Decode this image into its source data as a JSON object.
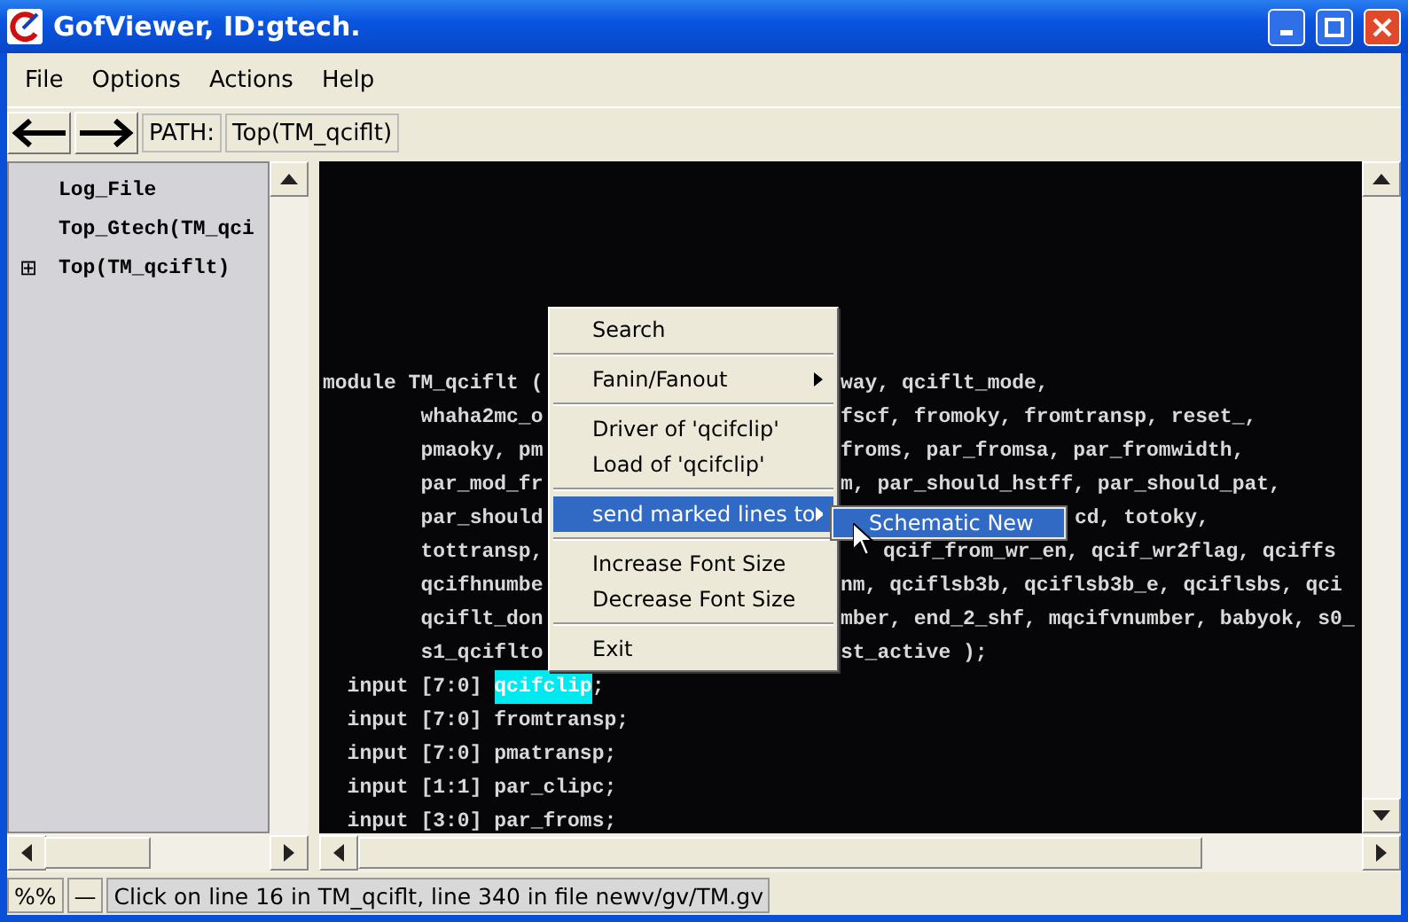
{
  "window": {
    "title": "GofViewer, ID:gtech."
  },
  "menu_bar": [
    "File",
    "Options",
    "Actions",
    "Help"
  ],
  "toolbar": {
    "path_label": "PATH:",
    "path": "Top(TM_qciflt)"
  },
  "tree": [
    {
      "label": "Log_File",
      "kind": "leaf"
    },
    {
      "label": "Top_Gtech(TM_qci",
      "kind": "leaf"
    },
    {
      "label": "Top(TM_qciflt)",
      "kind": "node",
      "expanded": false,
      "expander": "⊞"
    }
  ],
  "code_lines": [
    {
      "kind": "blank"
    },
    {
      "kind": "blank"
    },
    {
      "kind": "blank"
    },
    {
      "kind": "blank"
    },
    {
      "kind": "blank"
    },
    {
      "kind": "blank"
    },
    {
      "kind": "covered",
      "left": "module TM_qciflt (",
      "right": "way, qciflt_mode,"
    },
    {
      "kind": "covered",
      "left": "        whaha2mc_o",
      "right": "fscf, fromoky, fromtransp, reset_,"
    },
    {
      "kind": "covered",
      "left": "        pmaoky, pm",
      "right": "froms, par_fromsa, par_fromwidth,"
    },
    {
      "kind": "covered",
      "left": "        par_mod_fr",
      "right": "m, par_should_hstff, par_should_pat,"
    },
    {
      "kind": "under_submenu",
      "left": "        par_should",
      "right": "cd, totoky,"
    },
    {
      "kind": "under_cursor",
      "left": "        tottransp,",
      "right": "qcif_from_wr_en, qcif_wr2flag, qciffs"
    },
    {
      "kind": "covered",
      "left": "        qcifhnumbe",
      "right": "nm, qciflsb3b, qciflsb3b_e, qciflsbs, qci"
    },
    {
      "kind": "covered",
      "left": "        qciflt_don",
      "right": "mber, end_2_shf, mqcifvnumber, babyok, s0_"
    },
    {
      "kind": "covered",
      "left": "        s1_qciflto",
      "right": "st_active );"
    },
    {
      "kind": "marked",
      "left": "  input [7:0] ",
      "mark": "qcifclip",
      "right": ";"
    },
    {
      "kind": "plain",
      "text": "  input [7:0] fromtransp;"
    },
    {
      "kind": "plain",
      "text": "  input [7:0] pmatransp;"
    },
    {
      "kind": "plain",
      "text": "  input [1:1] par_clipc;"
    },
    {
      "kind": "plain",
      "text": "  input [3:0] par_froms;"
    }
  ],
  "context_menu": [
    {
      "kind": "item",
      "label": "Search",
      "selected": false
    },
    {
      "kind": "separator"
    },
    {
      "kind": "submenu",
      "label": "Fanin/Fanout",
      "selected": false
    },
    {
      "kind": "separator"
    },
    {
      "kind": "item",
      "label": "Driver of 'qcifclip'",
      "selected": false
    },
    {
      "kind": "item",
      "label": "Load of 'qcifclip'",
      "selected": false
    },
    {
      "kind": "separator"
    },
    {
      "kind": "submenu",
      "label": "send marked lines to",
      "selected": true
    },
    {
      "kind": "separator"
    },
    {
      "kind": "item",
      "label": "Increase Font Size",
      "selected": false
    },
    {
      "kind": "item",
      "label": "Decrease Font Size",
      "selected": false
    },
    {
      "kind": "separator"
    },
    {
      "kind": "item",
      "label": "Exit",
      "selected": false
    }
  ],
  "submenu": [
    {
      "label": "Schematic New",
      "selected": true
    }
  ],
  "status_bar": {
    "mode": "%%",
    "indicator": "—",
    "message": "Click on line 16 in TM_qciflt, line 340 in file newv/gv/TM.gv"
  }
}
